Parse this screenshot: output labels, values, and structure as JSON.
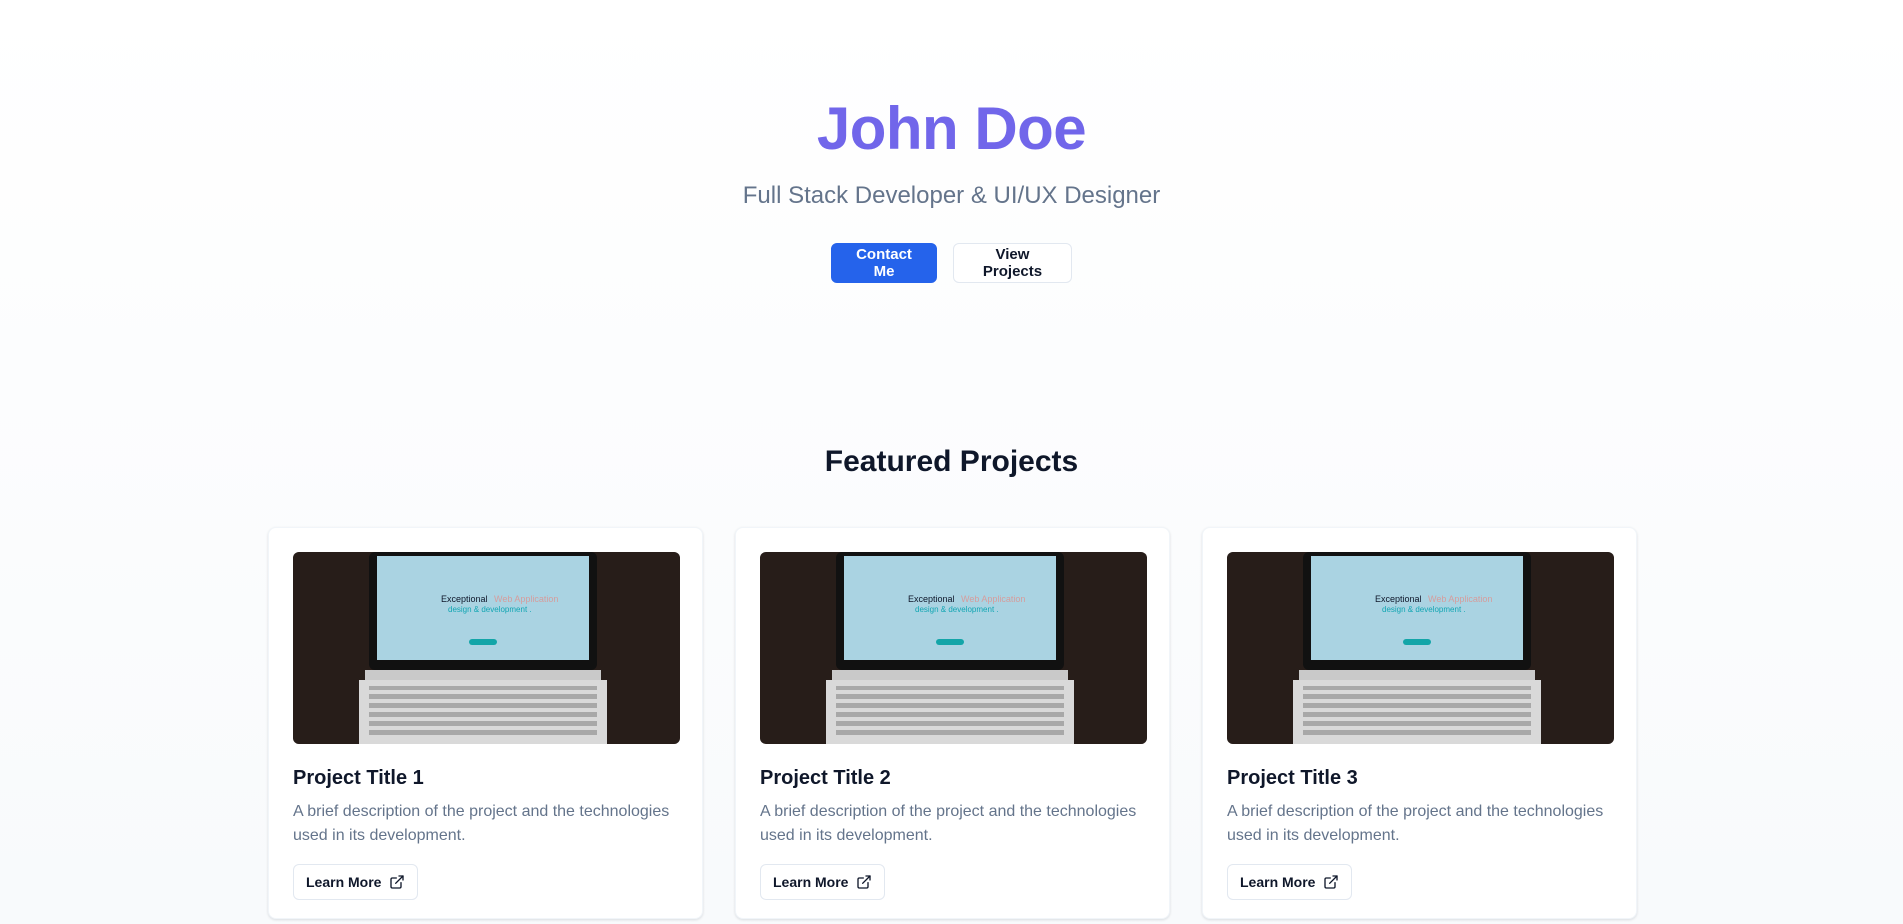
{
  "hero": {
    "name": "John Doe",
    "subtitle": "Full Stack Developer & UI/UX Designer",
    "contact_label": "Contact Me",
    "projects_label": "View Projects"
  },
  "projects": {
    "heading": "Featured Projects",
    "items": [
      {
        "title": "Project Title 1",
        "description": "A brief description of the project and the technologies used in its development.",
        "button_label": "Learn More",
        "screen_text_line1": "Exceptional",
        "screen_text_line1b": "Web Application",
        "screen_text_line2": "design & development ."
      },
      {
        "title": "Project Title 2",
        "description": "A brief description of the project and the technologies used in its development.",
        "button_label": "Learn More",
        "screen_text_line1": "Exceptional",
        "screen_text_line1b": "Web Application",
        "screen_text_line2": "design & development ."
      },
      {
        "title": "Project Title 3",
        "description": "A brief description of the project and the technologies used in its development.",
        "button_label": "Learn More",
        "screen_text_line1": "Exceptional",
        "screen_text_line1b": "Web Application",
        "screen_text_line2": "design & development ."
      }
    ]
  },
  "icons": {
    "card_button_icon": "external-link-icon"
  },
  "colors": {
    "accent": "#7166ea",
    "primary_button": "#2563eb",
    "muted_text": "#64748b"
  }
}
